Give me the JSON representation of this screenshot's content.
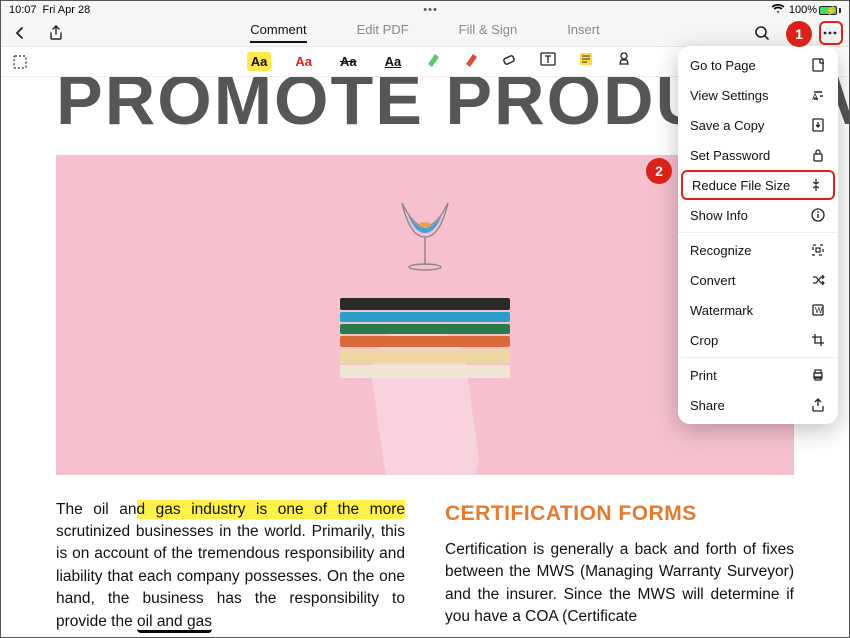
{
  "status": {
    "time": "10:07",
    "date": "Fri Apr 28",
    "center": "•••",
    "battery_pct": "100%"
  },
  "toolbar": {
    "tabs": [
      "Comment",
      "Edit PDF",
      "Fill & Sign",
      "Insert"
    ],
    "active_tab": 0
  },
  "doc": {
    "headline": "PROMOTE PRODUCTIV",
    "col1_pre": "The oil an",
    "col1_hl": "d gas industry is one of the more",
    "col1_rest": " scrutinized businesses in the world. Primarily, this is on account of the tremendous responsibility and liability that each company possesses. On the one hand, the business has the responsibility to provide the ",
    "col1_scribble": "oil and gas",
    "col2_title": "CERTIFICATION FORMS",
    "col2_body": "Certification is generally a back and forth of fixes between the MWS (Managing Warranty Surveyor) and the insurer. Since the MWS will determine if you have a COA (Certificate"
  },
  "menu": {
    "items": [
      {
        "label": "Go to Page",
        "icon": "page"
      },
      {
        "label": "View Settings",
        "icon": "text"
      },
      {
        "label": "Save a Copy",
        "icon": "save"
      },
      {
        "label": "Set Password",
        "icon": "lock"
      },
      {
        "label": "Reduce File Size",
        "icon": "compress",
        "highlight": true
      },
      {
        "label": "Show Info",
        "icon": "info"
      },
      {
        "sep": true
      },
      {
        "label": "Recognize",
        "icon": "scan"
      },
      {
        "label": "Convert",
        "icon": "shuffle"
      },
      {
        "label": "Watermark",
        "icon": "watermark"
      },
      {
        "label": "Crop",
        "icon": "crop"
      },
      {
        "sep": true
      },
      {
        "label": "Print",
        "icon": "print"
      },
      {
        "label": "Share",
        "icon": "share"
      }
    ]
  },
  "callouts": {
    "one": "1",
    "two": "2"
  }
}
